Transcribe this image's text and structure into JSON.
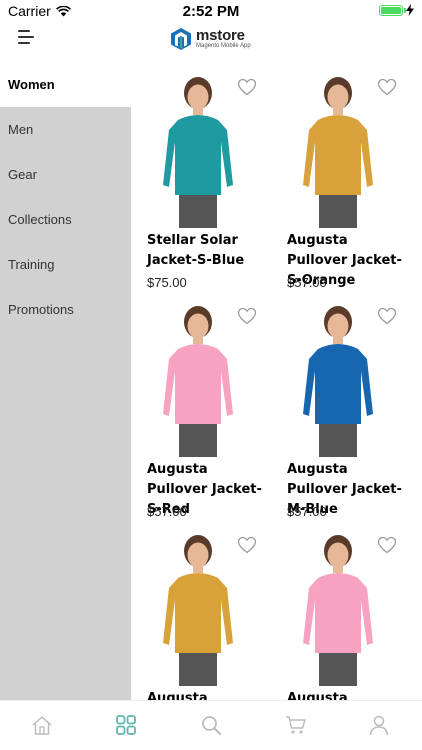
{
  "status": {
    "carrier": "Carrier",
    "time": "2:52 PM"
  },
  "brand": {
    "name": "mstore",
    "subtitle": "Magento Mobile App"
  },
  "sidebar": {
    "items": [
      {
        "label": "Women"
      },
      {
        "label": "Men"
      },
      {
        "label": "Gear"
      },
      {
        "label": "Collections"
      },
      {
        "label": "Training"
      },
      {
        "label": "Promotions"
      }
    ]
  },
  "products": [
    {
      "name": "Stellar Solar Jacket-S-Blue",
      "price": "$75.00",
      "color": "#1f9aa0"
    },
    {
      "name": "Augusta Pullover Jacket-S-Orange",
      "price": "$57.00",
      "color": "#d9a13a"
    },
    {
      "name": "Augusta Pullover Jacket-S-Red",
      "price": "$57.00",
      "color": "#f7a2c0"
    },
    {
      "name": "Augusta Pullover Jacket-M-Blue",
      "price": "$57.00",
      "color": "#1766b0"
    },
    {
      "name": "Augusta Pullover",
      "price": "",
      "color": "#d9a13a"
    },
    {
      "name": "Augusta Pullover",
      "price": "",
      "color": "#f7a2c0"
    }
  ],
  "colors": {
    "accent": "#3aa8a0",
    "sidebar_bg": "#d1d1d1",
    "active_tab": "#5fb8b0"
  },
  "tabs": [
    {
      "icon": "home-icon"
    },
    {
      "icon": "categories-icon"
    },
    {
      "icon": "search-icon"
    },
    {
      "icon": "cart-icon"
    },
    {
      "icon": "account-icon"
    }
  ]
}
